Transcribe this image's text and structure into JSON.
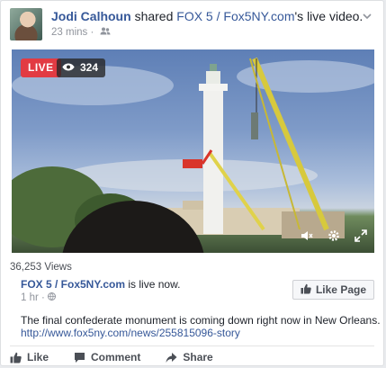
{
  "post": {
    "author": "Jodi Calhoun",
    "shared_word": "shared",
    "page_name": "FOX 5 / Fox5NY.com",
    "possessive_suffix": "'s live video.",
    "timestamp": "23 mins",
    "privacy_icon": "friends-icon"
  },
  "video": {
    "live_label": "LIVE",
    "viewer_count": "324"
  },
  "views_text": "36,253 Views",
  "shared": {
    "page_name": "FOX 5 / Fox5NY.com",
    "status": "is live now.",
    "timestamp": "1 hr",
    "privacy_icon": "globe-icon",
    "like_page_label": "Like Page",
    "text": "The final confederate monument is coming down right now in New Orleans.",
    "url": "http://www.fox5ny.com/news/255815096-story"
  },
  "actions": {
    "like": "Like",
    "comment": "Comment",
    "share": "Share"
  },
  "colors": {
    "link": "#365899",
    "live": "#e23b43",
    "text": "#1d2129",
    "meta": "#90949c"
  }
}
